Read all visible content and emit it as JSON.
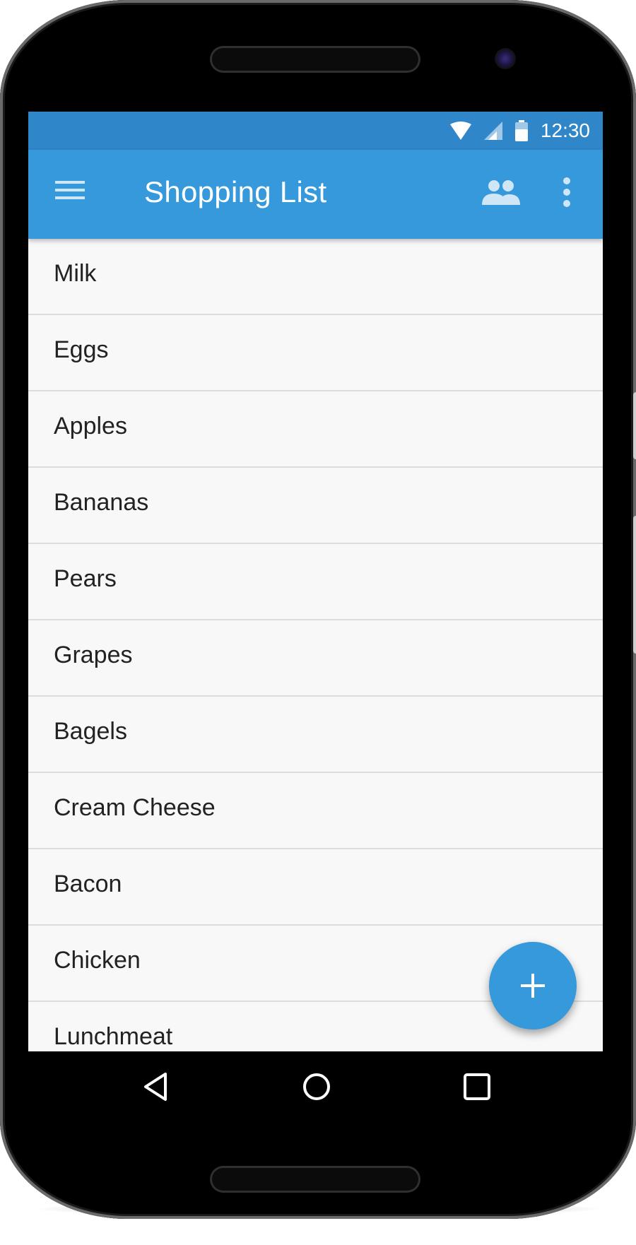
{
  "status_bar": {
    "time": "12:30"
  },
  "app_bar": {
    "title": "Shopping List"
  },
  "list": {
    "items": [
      "Milk",
      "Eggs",
      "Apples",
      "Bananas",
      "Pears",
      "Grapes",
      "Bagels",
      "Cream Cheese",
      "Bacon",
      "Chicken",
      "Lunchmeat"
    ]
  },
  "colors": {
    "status_bar": "#2f86c8",
    "app_bar": "#3599db",
    "fab": "#3599db",
    "list_background": "#f8f8f8",
    "divider": "#dcdcdc"
  },
  "icons": {
    "status": [
      "wifi-icon",
      "signal-icon",
      "battery-icon"
    ],
    "app_bar": [
      "menu-icon",
      "people-icon",
      "more-vertical-icon"
    ],
    "fab": "plus-icon",
    "navigation": [
      "back-icon",
      "home-icon",
      "recents-icon"
    ]
  }
}
